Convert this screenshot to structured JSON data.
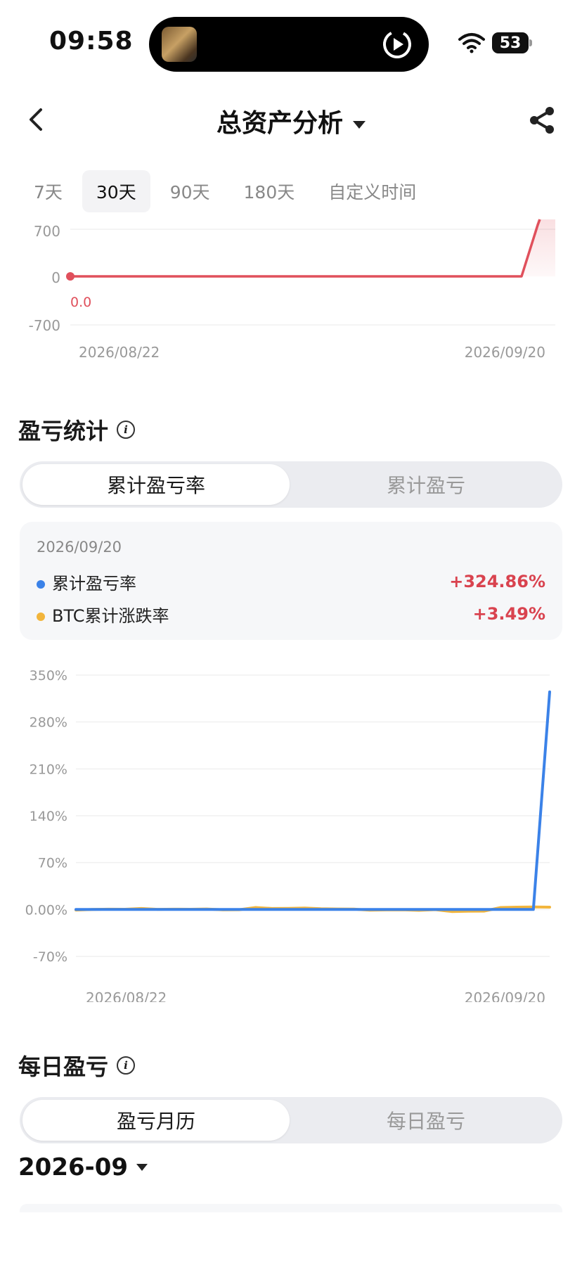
{
  "status_bar": {
    "time": "09:58",
    "battery": "53"
  },
  "header": {
    "title": "总资产分析",
    "back_icon": "chevron-left-icon",
    "share_icon": "share-icon"
  },
  "range_tabs": [
    {
      "label": "7天",
      "active": false
    },
    {
      "label": "30天",
      "active": true
    },
    {
      "label": "90天",
      "active": false
    },
    {
      "label": "180天",
      "active": false
    },
    {
      "label": "自定义时间",
      "active": false
    }
  ],
  "asset_chart": {
    "y_ticks": [
      "700",
      "0",
      "-700"
    ],
    "start_label": "0.0",
    "x_labels": [
      "2026/08/22",
      "2026/09/20"
    ],
    "line_color": "#e0505c"
  },
  "pnl_stats": {
    "title": "盈亏统计",
    "segments": {
      "active": "累计盈亏率",
      "inactive": "累计盈亏"
    },
    "card": {
      "date": "2026/09/20",
      "rows": [
        {
          "label": "累计盈亏率",
          "value": "+324.86%",
          "dot_color": "#3b82e8"
        },
        {
          "label": "BTC累计涨跌率",
          "value": "+3.49%",
          "dot_color": "#f2b53c"
        }
      ]
    }
  },
  "chart_data": {
    "type": "line",
    "y_ticks": [
      "350%",
      "280%",
      "210%",
      "140%",
      "70%",
      "0.00%",
      "-70%"
    ],
    "ylim": [
      -70,
      350
    ],
    "x_labels": [
      "2026/08/22",
      "2026/09/20"
    ],
    "series": [
      {
        "name": "BTC累计涨跌率",
        "color": "#f2b53c",
        "values": [
          -0.8,
          0,
          0.5,
          0.3,
          1.5,
          0.2,
          0.5,
          0.4,
          0.8,
          -0.5,
          -0.3,
          3.0,
          1.5,
          1.7,
          2.2,
          1.2,
          0.8,
          0.6,
          -1.0,
          -0.6,
          -0.4,
          -1.2,
          -0.2,
          -3.0,
          -2.6,
          -2.4,
          3.0,
          3.5,
          3.8,
          3.49
        ]
      },
      {
        "name": "累计盈亏率",
        "color": "#3b82e8",
        "values": [
          0,
          0,
          0,
          0,
          0,
          0,
          0,
          0,
          0,
          0,
          0,
          0,
          0,
          0,
          0,
          0,
          0,
          0,
          0,
          0,
          0,
          0,
          0,
          0,
          0,
          0,
          0,
          0,
          0,
          324.86
        ]
      }
    ]
  },
  "daily_pnl": {
    "title": "每日盈亏",
    "segments": {
      "active": "盈亏月历",
      "inactive": "每日盈亏"
    },
    "month": "2026-09"
  }
}
